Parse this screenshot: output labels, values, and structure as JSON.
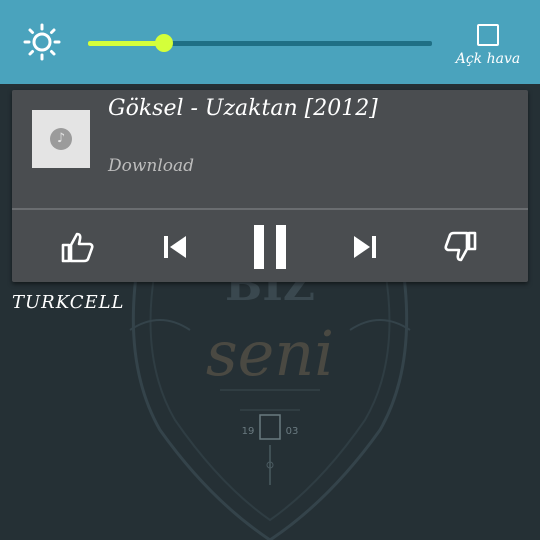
{
  "quick_settings": {
    "brightness_icon": "brightness-icon",
    "brightness_level": 0.22,
    "auto_brightness_label": "Açk hava",
    "auto_brightness_checked": false
  },
  "notification": {
    "title": "Göksel - Uzaktan [2012]",
    "subtitle": "Download",
    "album_icon": "music-note-icon",
    "state": "playing",
    "controls": [
      "thumbs-up-icon",
      "previous-icon",
      "pause-icon",
      "next-icon",
      "thumbs-down-icon"
    ]
  },
  "background": {
    "art_text_top": "BIZ",
    "art_text_main": "seni",
    "art_year_left": "19",
    "art_year_right": "03"
  },
  "status": {
    "carrier": "TURKCELL"
  },
  "colors": {
    "topbar": "#4aa3bd",
    "slider_accent": "#d4ff3a",
    "card": "#4a4d50",
    "background": "#253035"
  }
}
